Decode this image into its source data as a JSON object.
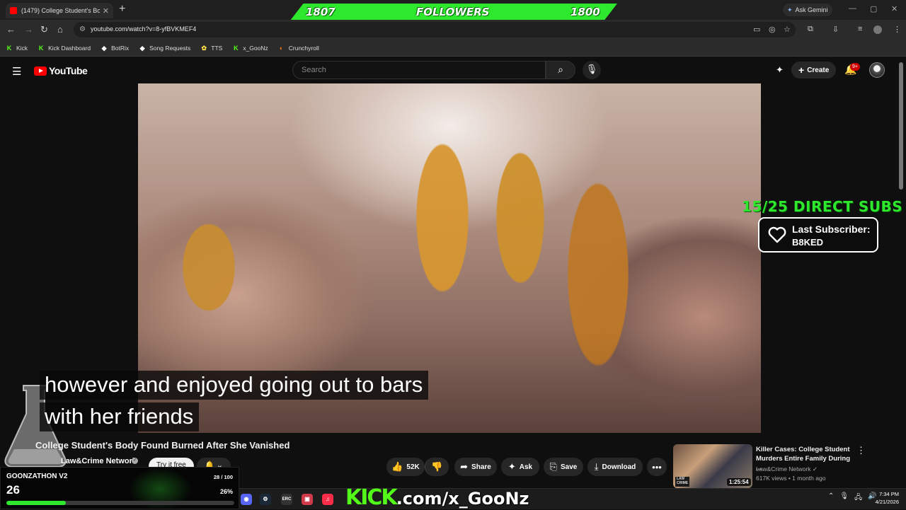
{
  "browser": {
    "tab_title": "(1479) College Student's Bo",
    "new_tab": "+",
    "ask_gemini": "Ask Gemini",
    "url": "youtube.com/watch?v=8-yfBVKMEF4",
    "bookmarks": [
      {
        "label": "Kick",
        "icon": "kick-icon",
        "color": "#53fc18"
      },
      {
        "label": "Kick Dashboard",
        "icon": "kick-icon",
        "color": "#53fc18"
      },
      {
        "label": "BotRix",
        "icon": "botrix-icon",
        "color": "#ffffff"
      },
      {
        "label": "Song Requests",
        "icon": "music-icon",
        "color": "#ffffff"
      },
      {
        "label": "TTS",
        "icon": "tts-icon",
        "color": "#ffe14a"
      },
      {
        "label": "x_GooNz",
        "icon": "kick-icon",
        "color": "#53fc18"
      },
      {
        "label": "Crunchyroll",
        "icon": "crunchyroll-icon",
        "color": "#f47521"
      }
    ]
  },
  "followers_banner": {
    "left_count": "1807",
    "label": "FOLLOWERS",
    "right_count": "1800",
    "color": "#2ee82e"
  },
  "youtube": {
    "logo_text": "YouTube",
    "search_placeholder": "Search",
    "create_label": "Create",
    "notification_badge": "9+"
  },
  "video": {
    "caption_lines": [
      "however and enjoyed going out to bars",
      "with her friends"
    ],
    "title": "College Student's Body Found Burned After She Vanished",
    "channel": "Law&Crime Network",
    "join_label": "Try it free",
    "likes": "52K",
    "actions": {
      "share": "Share",
      "ask": "Ask",
      "save": "Save",
      "download": "Download"
    }
  },
  "subs_goal": {
    "text": "15/25 DIRECT SUBS",
    "last_subscriber_label": "Last Subscriber:",
    "last_subscriber_name": "B8KED"
  },
  "recommended": {
    "title": "Killer Cases: College Student Murders Entire Family During ...",
    "channel": "Law&Crime Network",
    "meta": "617K views • 1 month ago",
    "duration": "1:25:54",
    "thumb_logo": "LAW CRIME"
  },
  "goal": {
    "name": "GOONZATHON V2",
    "count": "26",
    "ratio": "28 / 100",
    "percent_label": "26%",
    "progress": 0.26
  },
  "kick_overlay": {
    "brand": "KICK",
    "rest": ".com/x_GooNz"
  },
  "clock": {
    "time": "7:34 PM",
    "date": "4/21/2026"
  }
}
